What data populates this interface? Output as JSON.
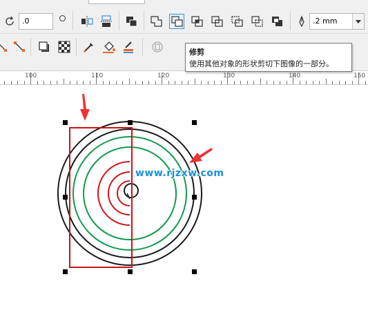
{
  "toolbar": {
    "rotation_value": ".0",
    "outline_width_value": ".2 mm",
    "buttons": {
      "mirror_horizontal": "mirror-horizontal-icon",
      "mirror_vertical": "mirror-vertical-icon",
      "combine": "combine-icon",
      "weld": "weld-icon",
      "trim": "trim-icon",
      "intersect": "intersect-icon",
      "simplify": "simplify-icon",
      "front_minus_back": "front-minus-back-icon",
      "back_minus_front": "back-minus-front-icon",
      "boundary": "boundary-icon",
      "outline_pen": "outline-pen-icon"
    }
  },
  "tooltip": {
    "title": "修剪",
    "description": "使用其他对象的形状剪切下图像的一部分。"
  },
  "ruler": {
    "labels": [
      "100",
      "110",
      "120",
      "130",
      "140",
      "150"
    ]
  },
  "watermark": {
    "text": "www.rjzxw.com"
  },
  "colors": {
    "ring_black": "#1a1a1a",
    "ring_green": "#0f9a4a",
    "ring_red": "#d0131c",
    "rect_red": "#cc1111",
    "arrow_red": "#ee3333",
    "accent_blue": "#3d8fd6",
    "watermark_blue": "#1a8fdc"
  }
}
